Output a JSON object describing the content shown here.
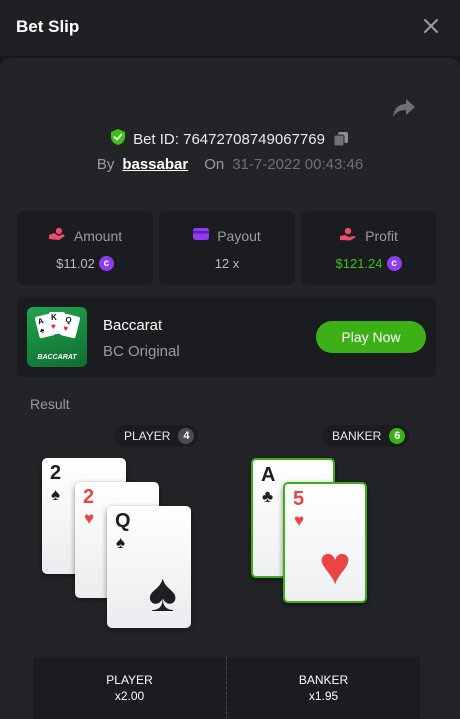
{
  "header": {
    "title": "Bet Slip",
    "close_icon": "close-icon"
  },
  "bet": {
    "id_label": "Bet ID: 76472708749067769",
    "by_label": "By",
    "user": "bassabar",
    "on_label": "On",
    "timestamp": "31-7-2022 00:43:46"
  },
  "stats": {
    "amount": {
      "label": "Amount",
      "value": "$11.02",
      "icon": "money-hand-icon",
      "color": "#f04b6e"
    },
    "payout": {
      "label": "Payout",
      "value": "12 x",
      "icon": "wallet-icon",
      "color": "#8e3bf2"
    },
    "profit": {
      "label": "Profit",
      "value": "$121.24",
      "icon": "profit-hand-icon",
      "color": "#3cc11a"
    }
  },
  "game": {
    "thumb_label": "BACCARAT",
    "name": "Baccarat",
    "subtitle": "BC Original",
    "play_label": "Play Now"
  },
  "result": {
    "label": "Result",
    "player": {
      "label": "PLAYER",
      "score": "4",
      "cards": [
        {
          "rank": "2",
          "suit": "♠"
        },
        {
          "rank": "2",
          "suit": "♥"
        },
        {
          "rank": "Q",
          "suit": "♠"
        }
      ]
    },
    "banker": {
      "label": "BANKER",
      "score": "6",
      "cards": [
        {
          "rank": "A",
          "suit": "♣"
        },
        {
          "rank": "5",
          "suit": "♥"
        }
      ]
    }
  },
  "bets": [
    {
      "label": "PLAYER",
      "odds": "x2.00"
    },
    {
      "label": "BANKER",
      "odds": "x1.95"
    }
  ],
  "colors": {
    "accent_green": "#3cb016",
    "coin_purple": "#8e3bf2",
    "badge_gray": "#4a4c52"
  }
}
